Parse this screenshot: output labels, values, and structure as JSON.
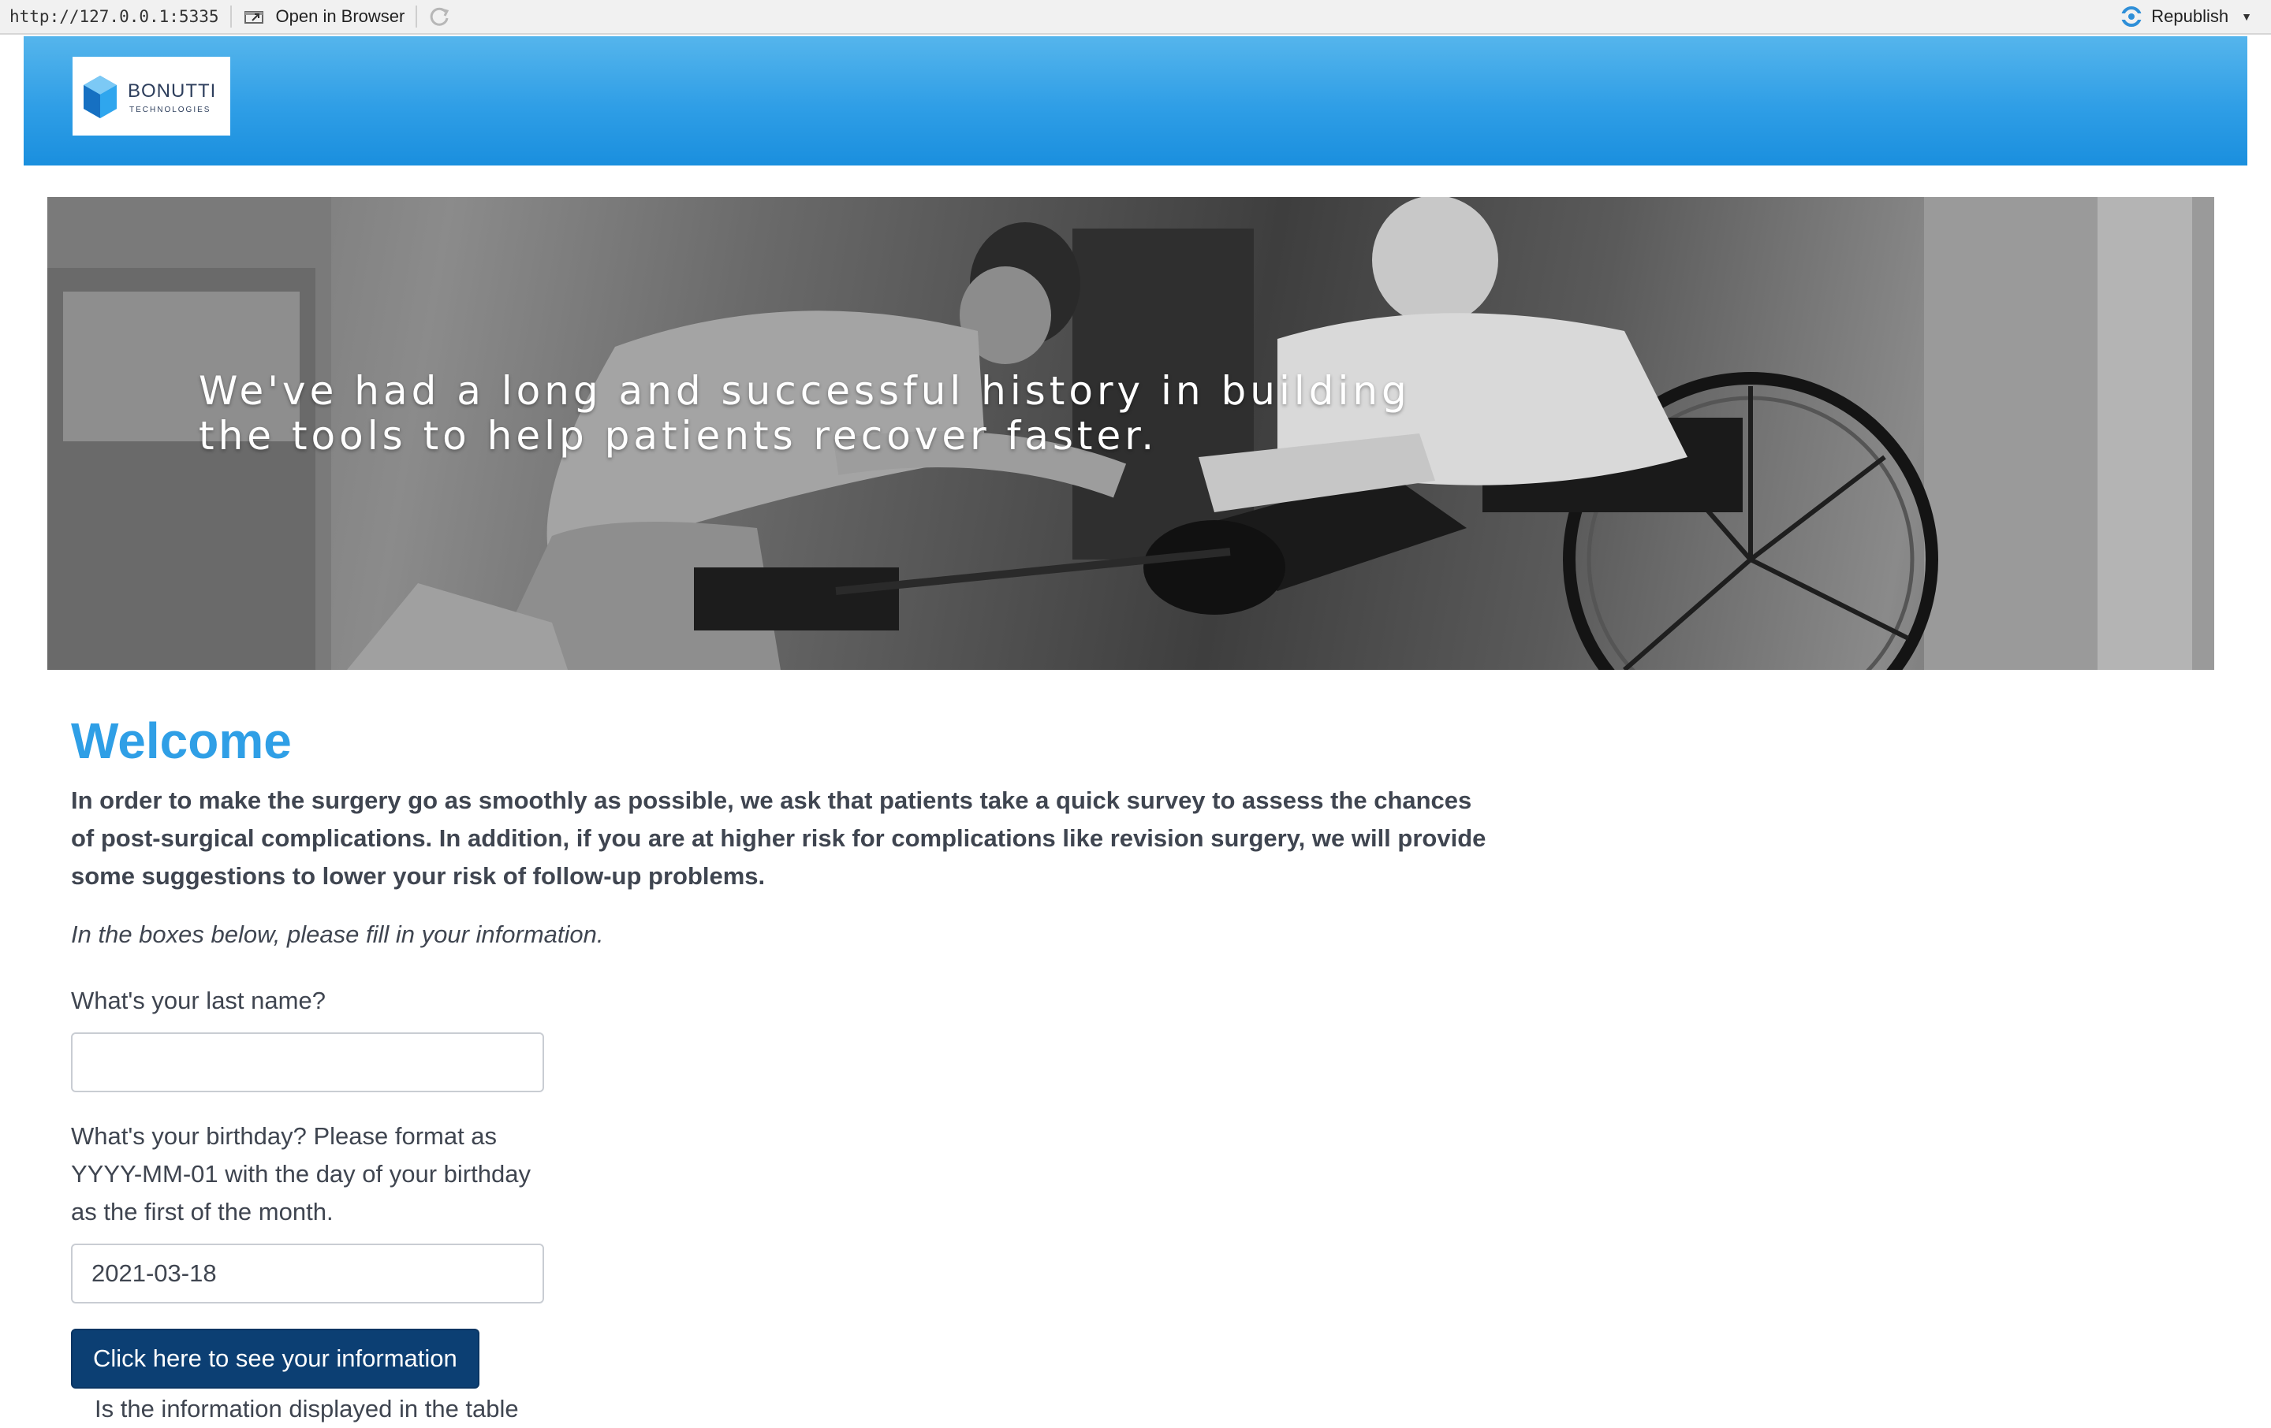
{
  "toolbar": {
    "url": "http://127.0.0.1:5335",
    "open_in_browser": "Open in Browser",
    "republish": "Republish"
  },
  "header": {
    "logo_name": "BONUTTI",
    "logo_subtitle": "TECHNOLOGIES",
    "brand_color": "#2f9ee6"
  },
  "hero": {
    "tagline": "We've had a long and successful history in building the tools to help patients recover faster."
  },
  "main": {
    "title": "Welcome",
    "intro": "In order to make the surgery go as smoothly as possible, we ask that patients take a quick survey to assess the chances of post-surgical complications. In addition, if you are at higher risk for complications like revision surgery, we will provide some suggestions to lower your risk of follow-up problems.",
    "instructions": "In the boxes below, please fill in your information.",
    "last_name_label": "What's your last name?",
    "last_name_value": "",
    "birthday_label": "What's your birthday? Please format as YYYY-MM-01 with the day of your birthday as the first of the month.",
    "birthday_value": "2021-03-18",
    "submit_label": "Click here to see your information",
    "confirm_partial": "Is the information displayed in the table"
  },
  "colors": {
    "title": "#2f9fe6",
    "button": "#0c3f73",
    "text": "#3f4550"
  }
}
